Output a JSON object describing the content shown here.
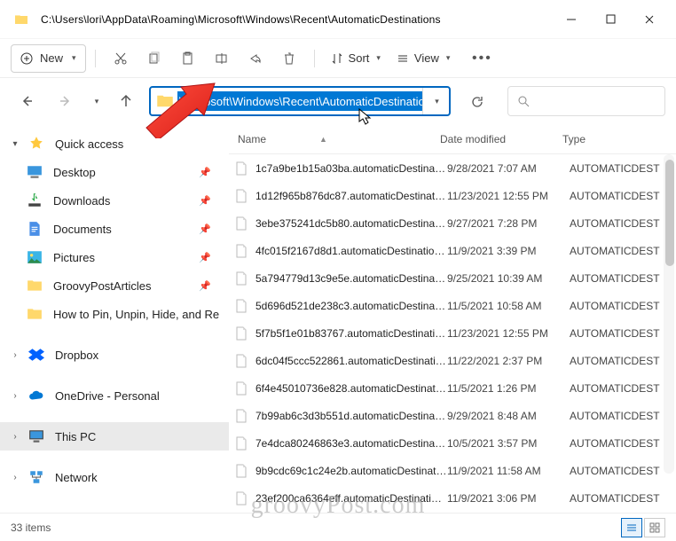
{
  "window": {
    "title": "C:\\Users\\lori\\AppData\\Roaming\\Microsoft\\Windows\\Recent\\AutomaticDestinations"
  },
  "toolbar": {
    "new_label": "New",
    "sort_label": "Sort",
    "view_label": "View"
  },
  "address": {
    "path": "\\Microsoft\\Windows\\Recent\\AutomaticDestinations"
  },
  "columns": {
    "name": "Name",
    "date": "Date modified",
    "type": "Type"
  },
  "sidebar": {
    "quick": "Quick access",
    "items": [
      {
        "label": "Desktop",
        "icon": "desktop"
      },
      {
        "label": "Downloads",
        "icon": "downloads"
      },
      {
        "label": "Documents",
        "icon": "documents"
      },
      {
        "label": "Pictures",
        "icon": "pictures"
      },
      {
        "label": "GroovyPostArticles",
        "icon": "folder"
      },
      {
        "label": "How to Pin, Unpin, Hide, and Re",
        "icon": "folder"
      }
    ],
    "dropbox": "Dropbox",
    "onedrive": "OneDrive - Personal",
    "thispc": "This PC",
    "network": "Network"
  },
  "files": [
    {
      "name": "1c7a9be1b15a03ba.automaticDestination...",
      "date": "9/28/2021 7:07 AM",
      "type": "AUTOMATICDEST"
    },
    {
      "name": "1d12f965b876dc87.automaticDestination...",
      "date": "11/23/2021 12:55 PM",
      "type": "AUTOMATICDEST"
    },
    {
      "name": "3ebe375241dc5b80.automaticDestination...",
      "date": "9/27/2021 7:28 PM",
      "type": "AUTOMATICDEST"
    },
    {
      "name": "4fc015f2167d8d1.automaticDestinations-...",
      "date": "11/9/2021 3:39 PM",
      "type": "AUTOMATICDEST"
    },
    {
      "name": "5a794779d13c9e5e.automaticDestination...",
      "date": "9/25/2021 10:39 AM",
      "type": "AUTOMATICDEST"
    },
    {
      "name": "5d696d521de238c3.automaticDestination...",
      "date": "11/5/2021 10:58 AM",
      "type": "AUTOMATICDEST"
    },
    {
      "name": "5f7b5f1e01b83767.automaticDestinations...",
      "date": "11/23/2021 12:55 PM",
      "type": "AUTOMATICDEST"
    },
    {
      "name": "6dc04f5ccc522861.automaticDestination...",
      "date": "11/22/2021 2:37 PM",
      "type": "AUTOMATICDEST"
    },
    {
      "name": "6f4e45010736e828.automaticDestination...",
      "date": "11/5/2021 1:26 PM",
      "type": "AUTOMATICDEST"
    },
    {
      "name": "7b99ab6c3d3b551d.automaticDestination...",
      "date": "9/29/2021 8:48 AM",
      "type": "AUTOMATICDEST"
    },
    {
      "name": "7e4dca80246863e3.automaticDestination...",
      "date": "10/5/2021 3:57 PM",
      "type": "AUTOMATICDEST"
    },
    {
      "name": "9b9cdc69c1c24e2b.automaticDestination...",
      "date": "11/9/2021 11:58 AM",
      "type": "AUTOMATICDEST"
    },
    {
      "name": "23ef200ca6364eff.automaticDestinations-...",
      "date": "11/9/2021 3:06 PM",
      "type": "AUTOMATICDEST"
    }
  ],
  "status": {
    "count": "33 items"
  },
  "watermark": "groovyPost.com"
}
